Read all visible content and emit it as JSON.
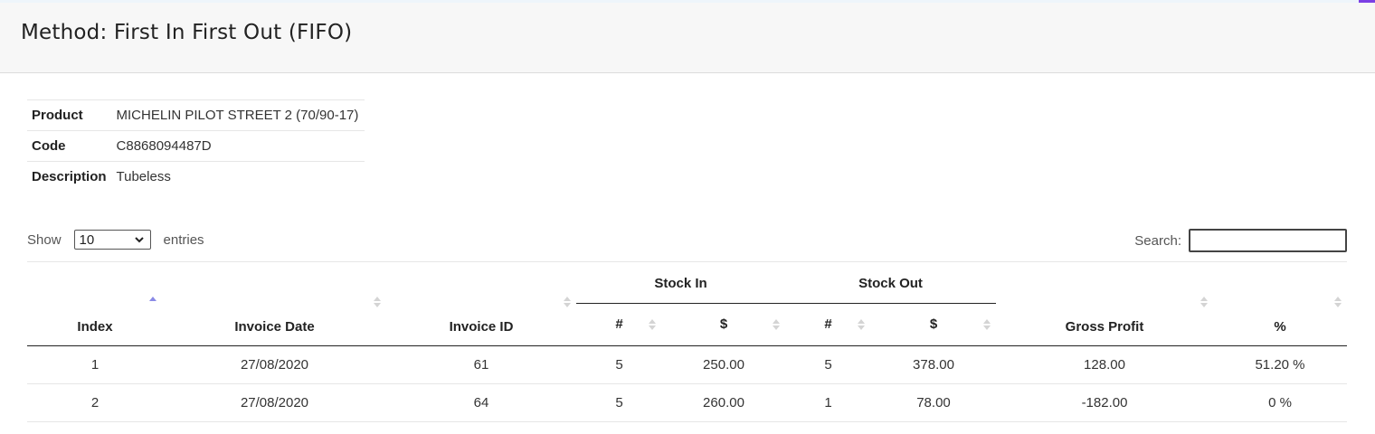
{
  "header": {
    "title": "Method: First In First Out (FIFO)"
  },
  "product_info": {
    "rows": [
      {
        "label": "Product",
        "value": "MICHELIN PILOT STREET 2 (70/90-17)"
      },
      {
        "label": "Code",
        "value": "C8868094487D"
      },
      {
        "label": "Description",
        "value": "Tubeless"
      }
    ]
  },
  "length_control": {
    "show_label": "Show",
    "selected": "10",
    "entries_label": "entries"
  },
  "search": {
    "label": "Search:",
    "value": "",
    "placeholder": ""
  },
  "table": {
    "group_headers": {
      "stock_in": "Stock In",
      "stock_out": "Stock Out"
    },
    "columns": {
      "index": "Index",
      "invoice_date": "Invoice Date",
      "invoice_id": "Invoice ID",
      "in_qty": "#",
      "in_amount": "$",
      "out_qty": "#",
      "out_amount": "$",
      "gross_profit": "Gross Profit",
      "percent": "%"
    },
    "sort": {
      "column": "index",
      "direction": "asc"
    },
    "rows": [
      {
        "index": "1",
        "invoice_date": "27/08/2020",
        "invoice_id": "61",
        "in_qty": "5",
        "in_amount": "250.00",
        "out_qty": "5",
        "out_amount": "378.00",
        "gross_profit": "128.00",
        "percent": "51.20 %"
      },
      {
        "index": "2",
        "invoice_date": "27/08/2020",
        "invoice_id": "64",
        "in_qty": "5",
        "in_amount": "260.00",
        "out_qty": "1",
        "out_amount": "78.00",
        "gross_profit": "-182.00",
        "percent": "0 %"
      }
    ]
  },
  "colors": {
    "accent": "#7b3fe4",
    "sort_active": "#8a8ae6",
    "sort_inactive": "#d4d4d4",
    "header_bg": "#f7f7f7"
  }
}
